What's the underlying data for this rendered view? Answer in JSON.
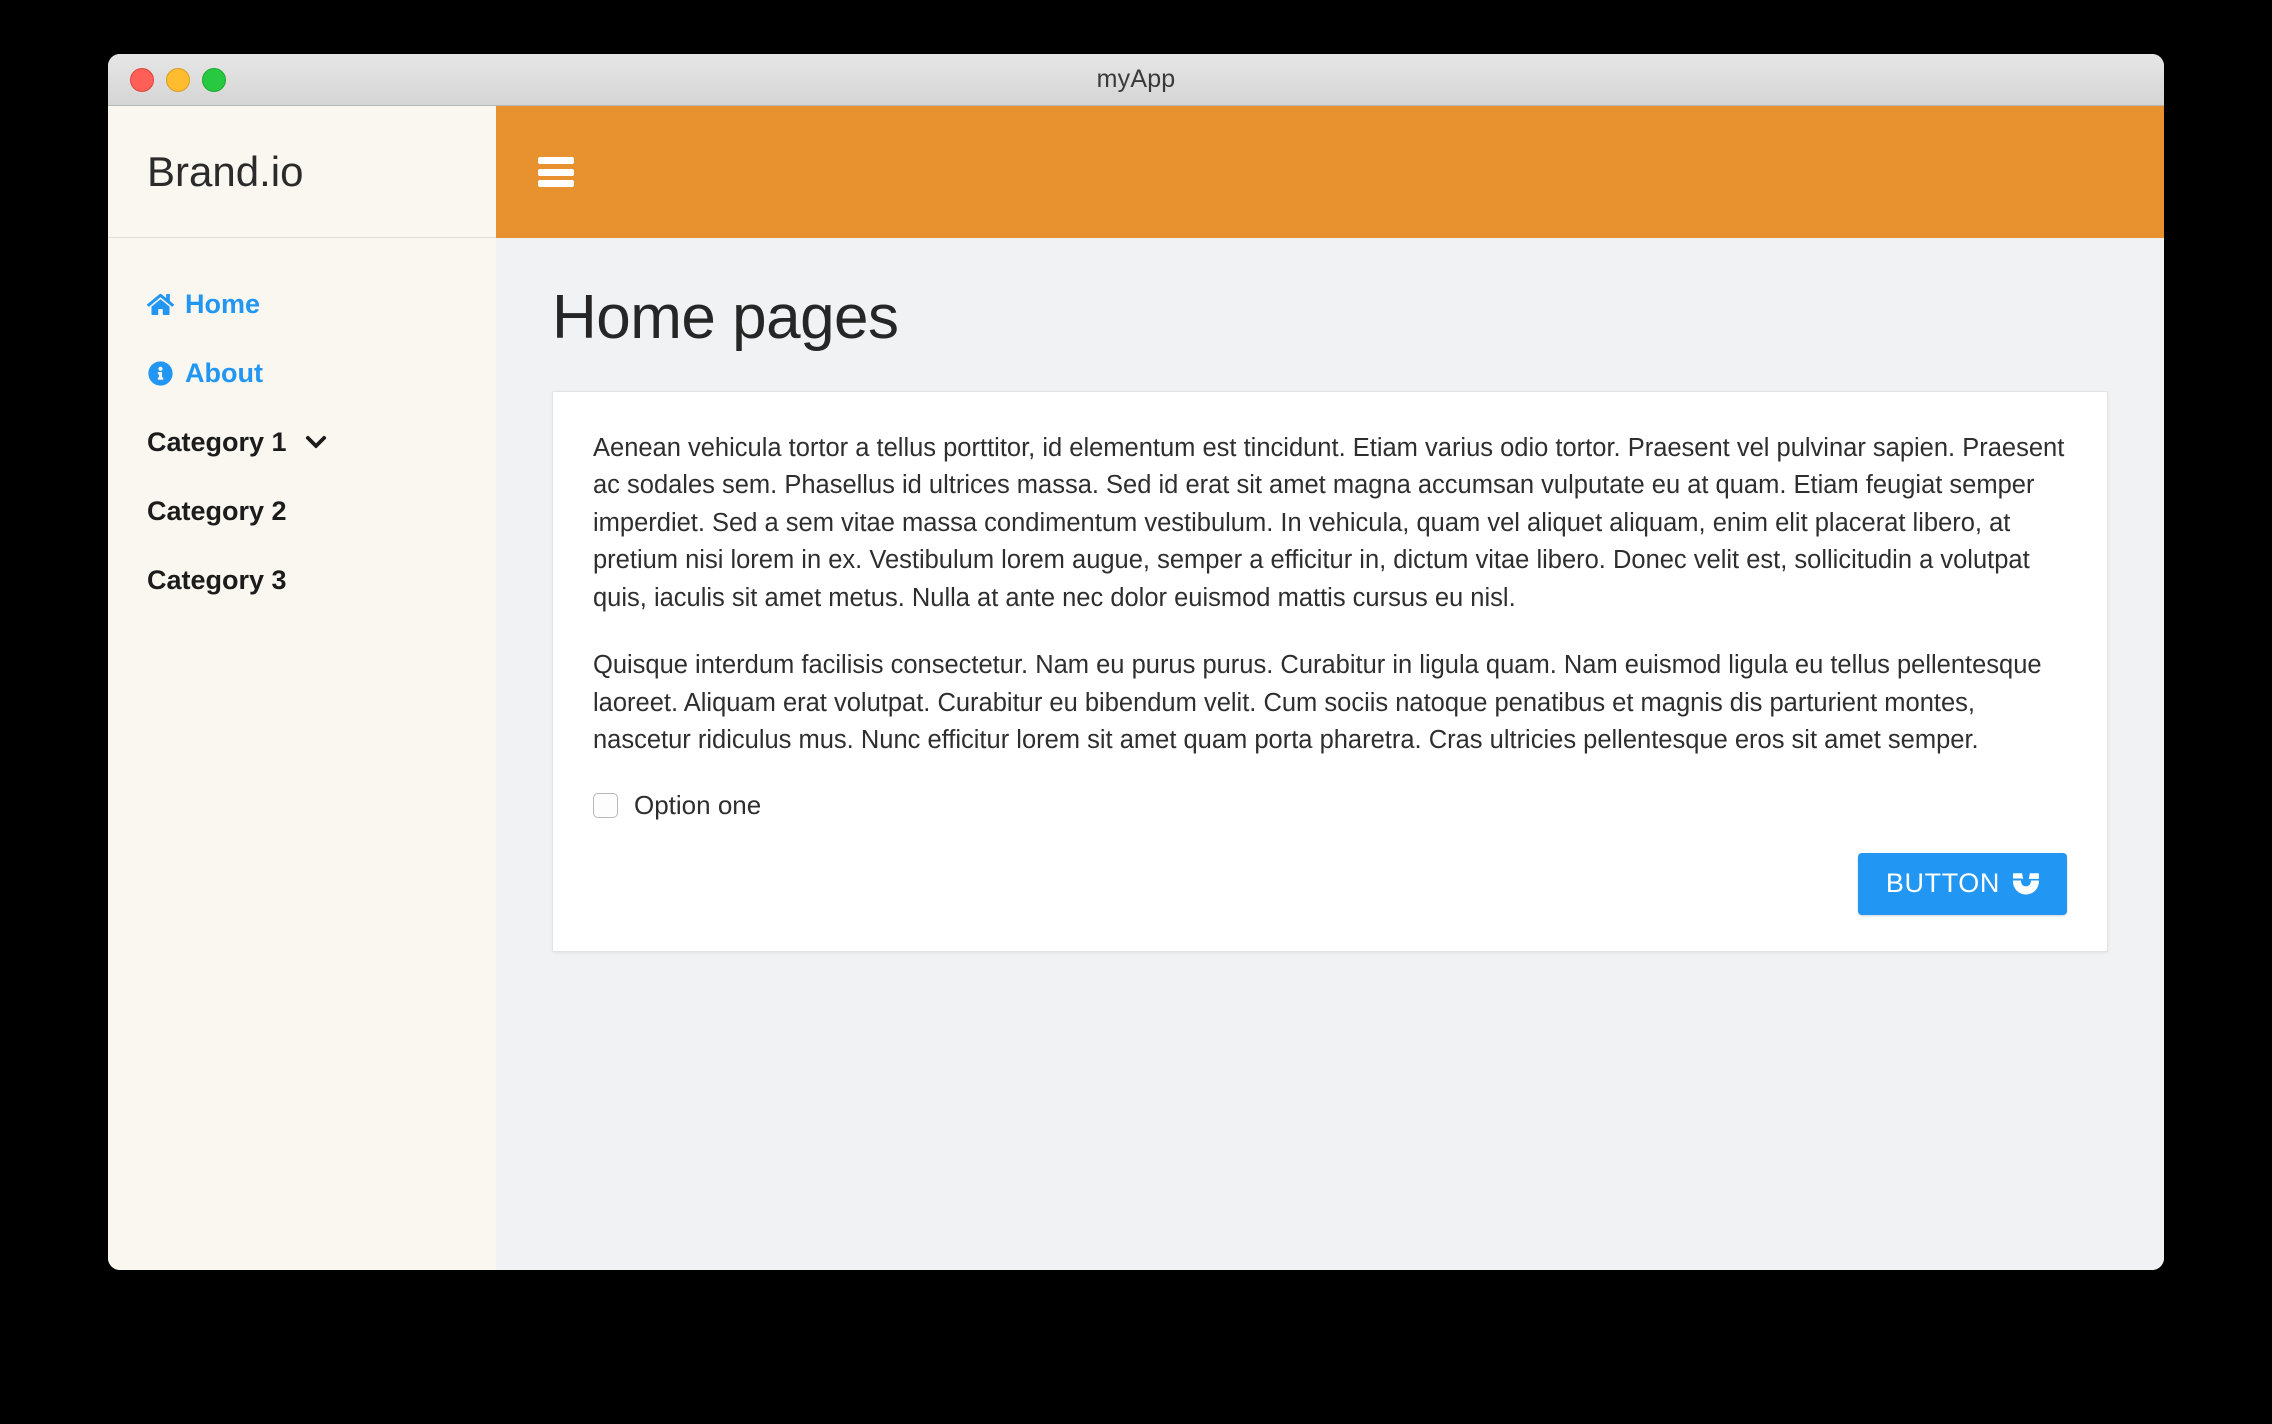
{
  "window": {
    "title": "myApp",
    "traffic_lights": [
      "close",
      "minimize",
      "maximize"
    ]
  },
  "colors": {
    "brand_bar": "#e8912f",
    "accent_link": "#2196f3",
    "button": "#2196f3",
    "sidebar_bg": "#faf6f0",
    "content_bg": "#f0f2f4",
    "card_bg": "#ffffff"
  },
  "sidebar": {
    "brand": "Brand.io",
    "items": [
      {
        "label": "Home",
        "icon": "home-icon",
        "style": "link",
        "has_chevron": false
      },
      {
        "label": "About",
        "icon": "info-circle-icon",
        "style": "link",
        "has_chevron": false
      },
      {
        "label": "Category 1",
        "icon": "",
        "style": "plain",
        "has_chevron": true
      },
      {
        "label": "Category 2",
        "icon": "",
        "style": "plain",
        "has_chevron": false
      },
      {
        "label": "Category 3",
        "icon": "",
        "style": "plain",
        "has_chevron": false
      }
    ]
  },
  "topbar": {
    "menu_icon": "hamburger-icon"
  },
  "main": {
    "page_title": "Home pages",
    "paragraphs": [
      "Aenean vehicula tortor a tellus porttitor, id elementum est tincidunt. Etiam varius odio tortor. Praesent vel pulvinar sapien. Praesent ac sodales sem. Phasellus id ultrices massa. Sed id erat sit amet magna accumsan vulputate eu at quam. Etiam feugiat semper imperdiet. Sed a sem vitae massa condimentum vestibulum. In vehicula, quam vel aliquet aliquam, enim elit placerat libero, at pretium nisi lorem in ex. Vestibulum lorem augue, semper a efficitur in, dictum vitae libero. Donec velit est, sollicitudin a volutpat quis, iaculis sit amet metus. Nulla at ante nec dolor euismod mattis cursus eu nisl.",
      "Quisque interdum facilisis consectetur. Nam eu purus purus. Curabitur in ligula quam. Nam euismod ligula eu tellus pellentesque laoreet. Aliquam erat volutpat. Curabitur eu bibendum velit. Cum sociis natoque penatibus et magnis dis parturient montes, nascetur ridiculus mus. Nunc efficitur lorem sit amet quam porta pharetra. Cras ultricies pellentesque eros sit amet semper."
    ],
    "checkbox": {
      "label": "Option one",
      "checked": false
    },
    "button": {
      "label": "BUTTON",
      "icon": "magnet-icon"
    }
  }
}
